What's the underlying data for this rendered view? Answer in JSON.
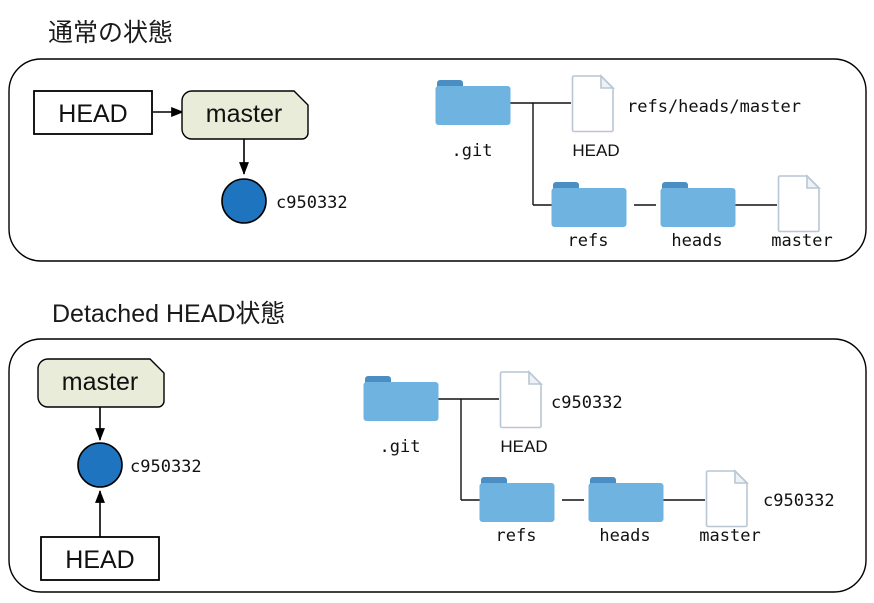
{
  "figure": {
    "sections": [
      {
        "title": "通常の状態",
        "left_diagram": {
          "head_box_label": "HEAD",
          "branch_tag_label": "master",
          "commit_hash": "c950332",
          "arrows": [
            {
              "name": "head-to-master",
              "from": "HEAD",
              "to": "master"
            },
            {
              "name": "master-to-commit",
              "from": "master",
              "to": "c950332"
            }
          ]
        },
        "file_tree": {
          "root": {
            "label": ".git",
            "icon": "folder-icon"
          },
          "children": [
            {
              "label": "HEAD",
              "icon": "file-icon",
              "content": "refs/heads/master"
            },
            {
              "label": "refs",
              "icon": "folder-icon",
              "children": [
                {
                  "label": "heads",
                  "icon": "folder-icon",
                  "children": [
                    {
                      "label": "master",
                      "icon": "file-icon",
                      "content": ""
                    }
                  ]
                }
              ]
            }
          ]
        }
      },
      {
        "title": "Detached HEAD状態",
        "left_diagram": {
          "head_box_label": "HEAD",
          "branch_tag_label": "master",
          "commit_hash": "c950332",
          "arrows": [
            {
              "name": "master-to-commit",
              "from": "master",
              "to": "c950332"
            },
            {
              "name": "head-to-commit",
              "from": "HEAD",
              "to": "c950332"
            }
          ]
        },
        "file_tree": {
          "root": {
            "label": ".git",
            "icon": "folder-icon"
          },
          "children": [
            {
              "label": "HEAD",
              "icon": "file-icon",
              "content": "c950332"
            },
            {
              "label": "refs",
              "icon": "folder-icon",
              "children": [
                {
                  "label": "heads",
                  "icon": "folder-icon",
                  "children": [
                    {
                      "label": "master",
                      "icon": "file-icon",
                      "content": "c950332"
                    }
                  ]
                }
              ]
            }
          ]
        }
      }
    ]
  },
  "colors": {
    "commit_fill": "#1f74bf",
    "branch_tag_fill": "#e8ecd8",
    "folder_body": "#6fb3e0",
    "folder_tab": "#4a8ec4",
    "file_border": "#b9c6d4",
    "panel_border": "#000000",
    "text": "#111111"
  }
}
